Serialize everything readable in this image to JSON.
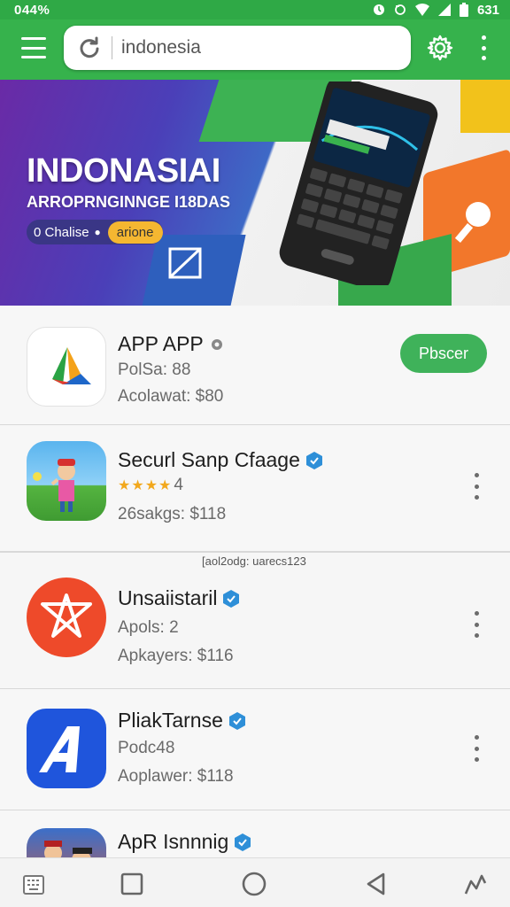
{
  "status_bar": {
    "time_left": "044%",
    "time_right": "631"
  },
  "search": {
    "value": "indonesia"
  },
  "banner": {
    "title": "INDONASIAI",
    "subtitle": "ARROPRNGINNGE I18DAS",
    "pill_text": "0 Chalise",
    "pill_button": "arione"
  },
  "apps": [
    {
      "title": "APP APP",
      "line1": "PolSa: 88",
      "line2": "Acolawat: $80",
      "action": "Pbscer"
    },
    {
      "title": "Securl Sanp Cfaage",
      "rating": "4",
      "stars": "★★★★",
      "line2": "26sakgs: $118"
    },
    {
      "title": "Unsaiistaril",
      "line1": "Apols: 2",
      "line2": "Apkayers: $116"
    },
    {
      "title": "PliakTarnse",
      "line1": "Podc48",
      "line2": "Aoplawer: $118"
    },
    {
      "title": "ApR Isnnnig"
    }
  ],
  "caption": "[aol2odg: uarecs123",
  "icons": [
    "menu-icon",
    "refresh-icon",
    "settings-gear-icon",
    "overflow-menu-icon",
    "verified-badge-icon",
    "recents-square-icon",
    "home-circle-icon",
    "back-triangle-icon",
    "assist-icon"
  ],
  "colors": {
    "brand_green": "#36b24c",
    "action_green": "#3fb25a",
    "verified_blue": "#2e8fd8",
    "star_orange": "#f2a81d"
  }
}
